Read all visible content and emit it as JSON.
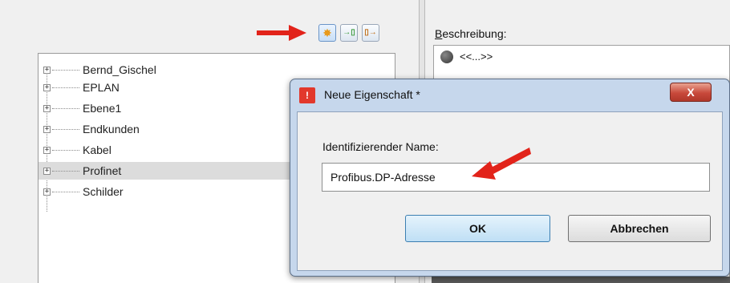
{
  "toolbar": {
    "buttons": [
      {
        "icon": "sun-new-icon",
        "glyph": "✸",
        "color": "#e89a1c"
      },
      {
        "icon": "import-icon",
        "glyph": "→▯",
        "color": "#3a9a3a"
      },
      {
        "icon": "export-icon",
        "glyph": "▯→",
        "color": "#c06a10"
      }
    ]
  },
  "tree": {
    "items": [
      {
        "label": "Bernd_Gischel",
        "selected": false
      },
      {
        "label": "EPLAN",
        "selected": false
      },
      {
        "label": "Ebene1",
        "selected": false
      },
      {
        "label": "Endkunden",
        "selected": false
      },
      {
        "label": "Kabel",
        "selected": false
      },
      {
        "label": "Profinet",
        "selected": true
      },
      {
        "label": "Schilder",
        "selected": false
      }
    ],
    "expander_glyph": "+"
  },
  "description": {
    "label_underlined": "B",
    "label_rest": "eschreibung:",
    "value": "<<...>>"
  },
  "dialog": {
    "title": "Neue Eigenschaft *",
    "close_glyph": "X",
    "warn_glyph": "!",
    "field_label": "Identifizierender Name:",
    "field_value": "Profibus.DP-Adresse",
    "ok_label": "OK",
    "cancel_label": "Abbrechen"
  },
  "colors": {
    "arrow": "#e2231a",
    "selection": "#dcdcdc",
    "dialog_frame": "#c6d7ec"
  }
}
